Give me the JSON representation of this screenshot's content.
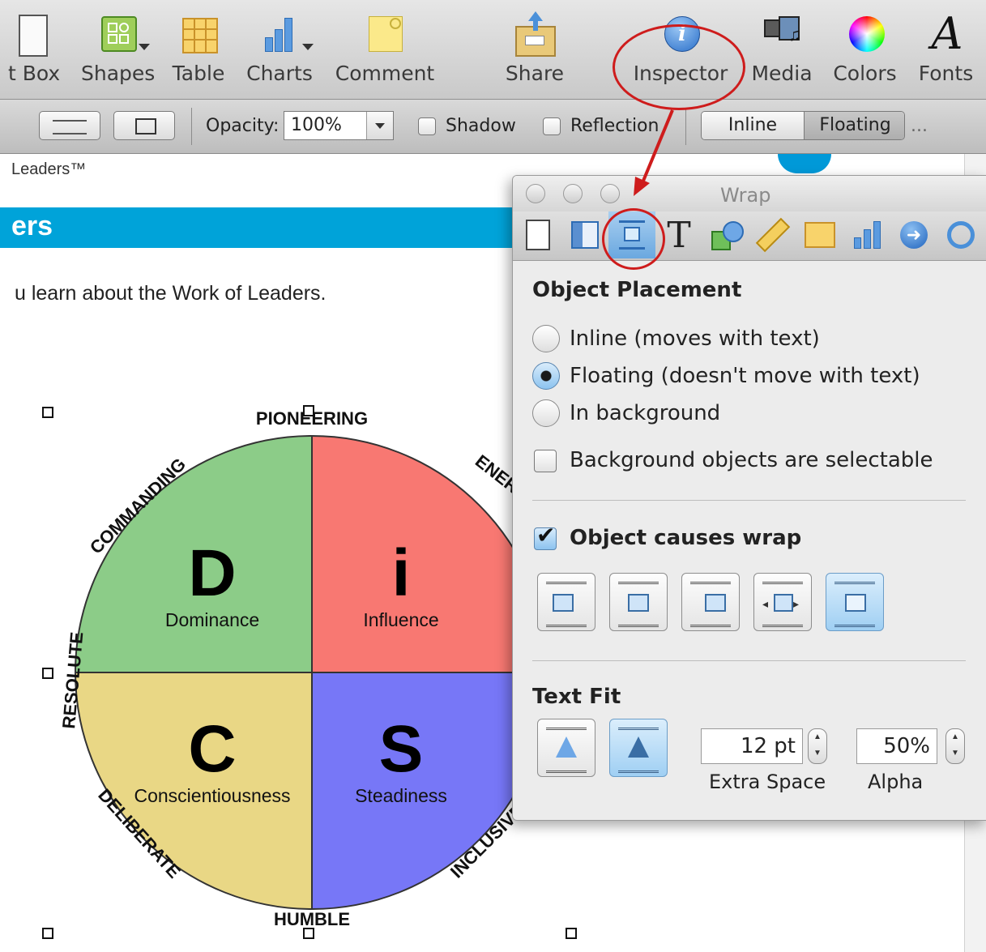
{
  "toolbar": {
    "items": [
      {
        "label": "t Box",
        "icon": "text-box-icon"
      },
      {
        "label": "Shapes",
        "icon": "shapes-icon"
      },
      {
        "label": "Table",
        "icon": "table-icon"
      },
      {
        "label": "Charts",
        "icon": "charts-icon"
      },
      {
        "label": "Comment",
        "icon": "comment-icon"
      },
      {
        "label": "Share",
        "icon": "share-icon"
      },
      {
        "label": "Inspector",
        "icon": "inspector-icon"
      },
      {
        "label": "Media",
        "icon": "media-icon"
      },
      {
        "label": "Colors",
        "icon": "colors-icon"
      },
      {
        "label": "Fonts",
        "icon": "fonts-icon"
      }
    ]
  },
  "format_bar": {
    "opacity_label": "Opacity:",
    "opacity_value": "100%",
    "shadow_label": "Shadow",
    "reflection_label": "Reflection",
    "inline_label": "Inline",
    "floating_label": "Floating",
    "overflow": "..."
  },
  "document": {
    "header_text": "Leaders™",
    "banner_text": "ers",
    "body_text": "u learn about the Work of Leaders.",
    "disc": {
      "quadrants": [
        {
          "letter": "D",
          "name": "Dominance",
          "color": "#8ccc88"
        },
        {
          "letter": "i",
          "name": "Influence",
          "color": "#f87872"
        },
        {
          "letter": "C",
          "name": "Conscientiousness",
          "color": "#e9d785"
        },
        {
          "letter": "S",
          "name": "Steadiness",
          "color": "#7777f7"
        }
      ],
      "ring_labels": [
        "PIONEERING",
        "ENERGIZING",
        "COMMANDING",
        "RESOLUTE",
        "DELIBERATE",
        "HUMBLE",
        "INCLUSIVE"
      ]
    }
  },
  "inspector": {
    "title": "Wrap",
    "tabs": [
      "document-icon",
      "layout-icon",
      "wrap-icon",
      "text-icon",
      "graphic-icon",
      "metrics-icon",
      "table-icon",
      "chart-icon",
      "link-icon",
      "quicktime-icon"
    ],
    "object_placement": {
      "title": "Object Placement",
      "options": [
        {
          "label": "Inline (moves with text)",
          "selected": false
        },
        {
          "label": "Floating (doesn't move with text)",
          "selected": true
        },
        {
          "label": "In background",
          "selected": false
        }
      ],
      "bg_selectable_label": "Background objects are selectable"
    },
    "wrap": {
      "causes_wrap_label": "Object causes wrap",
      "causes_wrap_checked": true
    },
    "text_fit": {
      "title": "Text Fit",
      "extra_space_value": "12 pt",
      "extra_space_label": "Extra Space",
      "alpha_value": "50%",
      "alpha_label": "Alpha"
    }
  },
  "colors": {
    "accent": "#ce1c1c",
    "banner": "#00a3d9",
    "selection": "#4a90d9"
  }
}
